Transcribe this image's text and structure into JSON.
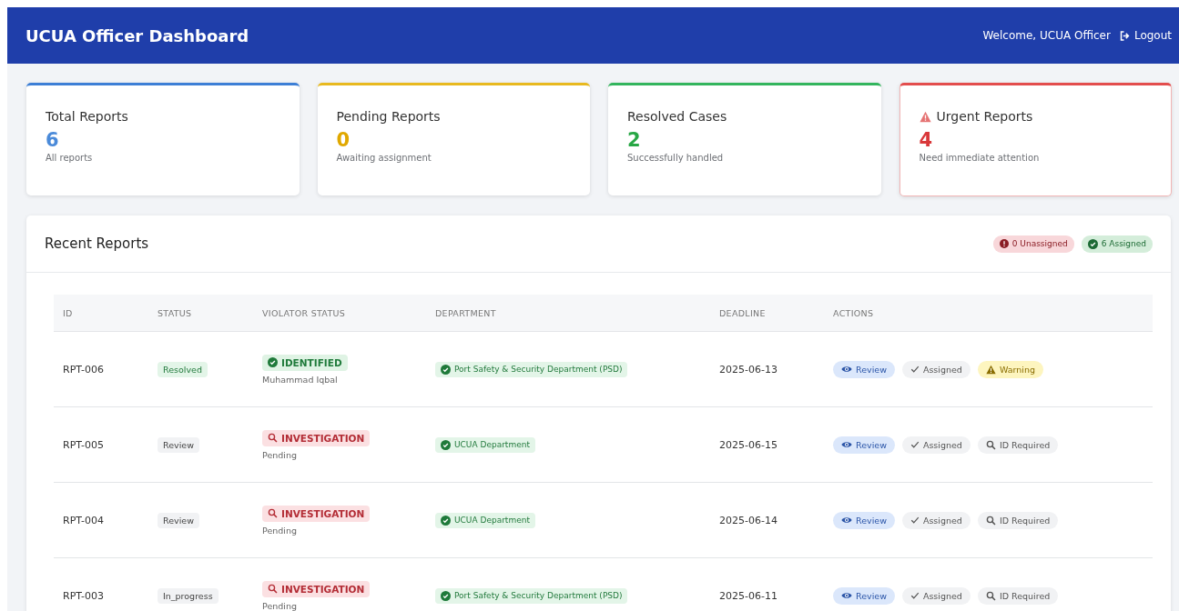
{
  "header": {
    "title": "UCUA Officer Dashboard",
    "welcome": "Welcome, UCUA Officer",
    "logout": "Logout"
  },
  "cards": [
    {
      "kind": "total",
      "title": "Total Reports",
      "value": "6",
      "caption": "All reports"
    },
    {
      "kind": "pending",
      "title": "Pending Reports",
      "value": "0",
      "caption": "Awaiting assignment"
    },
    {
      "kind": "resolved",
      "title": "Resolved Cases",
      "value": "2",
      "caption": "Successfully handled"
    },
    {
      "kind": "urgent",
      "title": "Urgent Reports",
      "value": "4",
      "caption": "Need immediate attention"
    }
  ],
  "recent": {
    "title": "Recent Reports",
    "badges": [
      {
        "kind": "unassigned",
        "label": "0 Unassigned"
      },
      {
        "kind": "assigned",
        "label": "6 Assigned"
      }
    ],
    "columns": [
      "ID",
      "STATUS",
      "VIOLATOR STATUS",
      "DEPARTMENT",
      "DEADLINE",
      "ACTIONS"
    ],
    "rows": [
      {
        "id": "RPT-006",
        "status": {
          "kind": "resolved",
          "label": "Resolved"
        },
        "violator": {
          "kind": "identified",
          "label": "IDENTIFIED",
          "note": "Muhammad Iqbal"
        },
        "department": "Port Safety & Security Department (PSD)",
        "deadline": "2025-06-13",
        "actions": [
          {
            "kind": "review",
            "label": "Review"
          },
          {
            "kind": "assigned",
            "label": "Assigned"
          },
          {
            "kind": "warning",
            "label": "Warning"
          }
        ]
      },
      {
        "id": "RPT-005",
        "status": {
          "kind": "review",
          "label": "Review"
        },
        "violator": {
          "kind": "investigation",
          "label": "INVESTIGATION",
          "note": "Pending"
        },
        "department": "UCUA Department",
        "deadline": "2025-06-15",
        "actions": [
          {
            "kind": "review",
            "label": "Review"
          },
          {
            "kind": "assigned",
            "label": "Assigned"
          },
          {
            "kind": "id-required",
            "label": "ID Required"
          }
        ]
      },
      {
        "id": "RPT-004",
        "status": {
          "kind": "review",
          "label": "Review"
        },
        "violator": {
          "kind": "investigation",
          "label": "INVESTIGATION",
          "note": "Pending"
        },
        "department": "UCUA Department",
        "deadline": "2025-06-14",
        "actions": [
          {
            "kind": "review",
            "label": "Review"
          },
          {
            "kind": "assigned",
            "label": "Assigned"
          },
          {
            "kind": "id-required",
            "label": "ID Required"
          }
        ]
      },
      {
        "id": "RPT-003",
        "status": {
          "kind": "in-progress",
          "label": "In_progress"
        },
        "violator": {
          "kind": "investigation",
          "label": "INVESTIGATION",
          "note": "Pending"
        },
        "department": "Port Safety & Security Department (PSD)",
        "deadline": "2025-06-11",
        "actions": [
          {
            "kind": "review",
            "label": "Review"
          },
          {
            "kind": "assigned",
            "label": "Assigned"
          },
          {
            "kind": "id-required",
            "label": "ID Required"
          }
        ]
      }
    ]
  }
}
